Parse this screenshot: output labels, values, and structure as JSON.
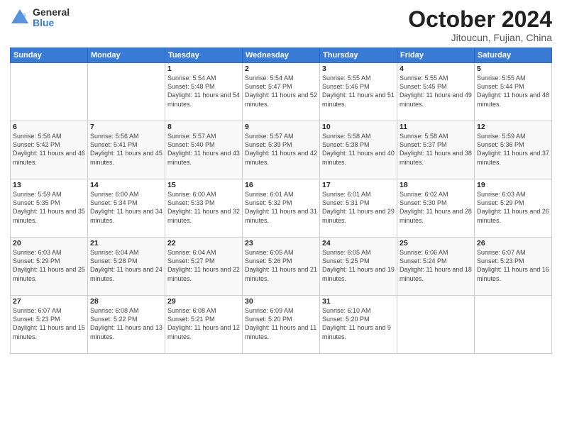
{
  "logo": {
    "general": "General",
    "blue": "Blue"
  },
  "title": {
    "month": "October 2024",
    "location": "Jitoucun, Fujian, China"
  },
  "weekdays": [
    "Sunday",
    "Monday",
    "Tuesday",
    "Wednesday",
    "Thursday",
    "Friday",
    "Saturday"
  ],
  "weeks": [
    [
      {
        "day": "",
        "detail": ""
      },
      {
        "day": "",
        "detail": ""
      },
      {
        "day": "1",
        "detail": "Sunrise: 5:54 AM\nSunset: 5:48 PM\nDaylight: 11 hours and 54 minutes."
      },
      {
        "day": "2",
        "detail": "Sunrise: 5:54 AM\nSunset: 5:47 PM\nDaylight: 11 hours and 52 minutes."
      },
      {
        "day": "3",
        "detail": "Sunrise: 5:55 AM\nSunset: 5:46 PM\nDaylight: 11 hours and 51 minutes."
      },
      {
        "day": "4",
        "detail": "Sunrise: 5:55 AM\nSunset: 5:45 PM\nDaylight: 11 hours and 49 minutes."
      },
      {
        "day": "5",
        "detail": "Sunrise: 5:55 AM\nSunset: 5:44 PM\nDaylight: 11 hours and 48 minutes."
      }
    ],
    [
      {
        "day": "6",
        "detail": "Sunrise: 5:56 AM\nSunset: 5:42 PM\nDaylight: 11 hours and 46 minutes."
      },
      {
        "day": "7",
        "detail": "Sunrise: 5:56 AM\nSunset: 5:41 PM\nDaylight: 11 hours and 45 minutes."
      },
      {
        "day": "8",
        "detail": "Sunrise: 5:57 AM\nSunset: 5:40 PM\nDaylight: 11 hours and 43 minutes."
      },
      {
        "day": "9",
        "detail": "Sunrise: 5:57 AM\nSunset: 5:39 PM\nDaylight: 11 hours and 42 minutes."
      },
      {
        "day": "10",
        "detail": "Sunrise: 5:58 AM\nSunset: 5:38 PM\nDaylight: 11 hours and 40 minutes."
      },
      {
        "day": "11",
        "detail": "Sunrise: 5:58 AM\nSunset: 5:37 PM\nDaylight: 11 hours and 38 minutes."
      },
      {
        "day": "12",
        "detail": "Sunrise: 5:59 AM\nSunset: 5:36 PM\nDaylight: 11 hours and 37 minutes."
      }
    ],
    [
      {
        "day": "13",
        "detail": "Sunrise: 5:59 AM\nSunset: 5:35 PM\nDaylight: 11 hours and 35 minutes."
      },
      {
        "day": "14",
        "detail": "Sunrise: 6:00 AM\nSunset: 5:34 PM\nDaylight: 11 hours and 34 minutes."
      },
      {
        "day": "15",
        "detail": "Sunrise: 6:00 AM\nSunset: 5:33 PM\nDaylight: 11 hours and 32 minutes."
      },
      {
        "day": "16",
        "detail": "Sunrise: 6:01 AM\nSunset: 5:32 PM\nDaylight: 11 hours and 31 minutes."
      },
      {
        "day": "17",
        "detail": "Sunrise: 6:01 AM\nSunset: 5:31 PM\nDaylight: 11 hours and 29 minutes."
      },
      {
        "day": "18",
        "detail": "Sunrise: 6:02 AM\nSunset: 5:30 PM\nDaylight: 11 hours and 28 minutes."
      },
      {
        "day": "19",
        "detail": "Sunrise: 6:03 AM\nSunset: 5:29 PM\nDaylight: 11 hours and 26 minutes."
      }
    ],
    [
      {
        "day": "20",
        "detail": "Sunrise: 6:03 AM\nSunset: 5:29 PM\nDaylight: 11 hours and 25 minutes."
      },
      {
        "day": "21",
        "detail": "Sunrise: 6:04 AM\nSunset: 5:28 PM\nDaylight: 11 hours and 24 minutes."
      },
      {
        "day": "22",
        "detail": "Sunrise: 6:04 AM\nSunset: 5:27 PM\nDaylight: 11 hours and 22 minutes."
      },
      {
        "day": "23",
        "detail": "Sunrise: 6:05 AM\nSunset: 5:26 PM\nDaylight: 11 hours and 21 minutes."
      },
      {
        "day": "24",
        "detail": "Sunrise: 6:05 AM\nSunset: 5:25 PM\nDaylight: 11 hours and 19 minutes."
      },
      {
        "day": "25",
        "detail": "Sunrise: 6:06 AM\nSunset: 5:24 PM\nDaylight: 11 hours and 18 minutes."
      },
      {
        "day": "26",
        "detail": "Sunrise: 6:07 AM\nSunset: 5:23 PM\nDaylight: 11 hours and 16 minutes."
      }
    ],
    [
      {
        "day": "27",
        "detail": "Sunrise: 6:07 AM\nSunset: 5:23 PM\nDaylight: 11 hours and 15 minutes."
      },
      {
        "day": "28",
        "detail": "Sunrise: 6:08 AM\nSunset: 5:22 PM\nDaylight: 11 hours and 13 minutes."
      },
      {
        "day": "29",
        "detail": "Sunrise: 6:08 AM\nSunset: 5:21 PM\nDaylight: 11 hours and 12 minutes."
      },
      {
        "day": "30",
        "detail": "Sunrise: 6:09 AM\nSunset: 5:20 PM\nDaylight: 11 hours and 11 minutes."
      },
      {
        "day": "31",
        "detail": "Sunrise: 6:10 AM\nSunset: 5:20 PM\nDaylight: 11 hours and 9 minutes."
      },
      {
        "day": "",
        "detail": ""
      },
      {
        "day": "",
        "detail": ""
      }
    ]
  ]
}
